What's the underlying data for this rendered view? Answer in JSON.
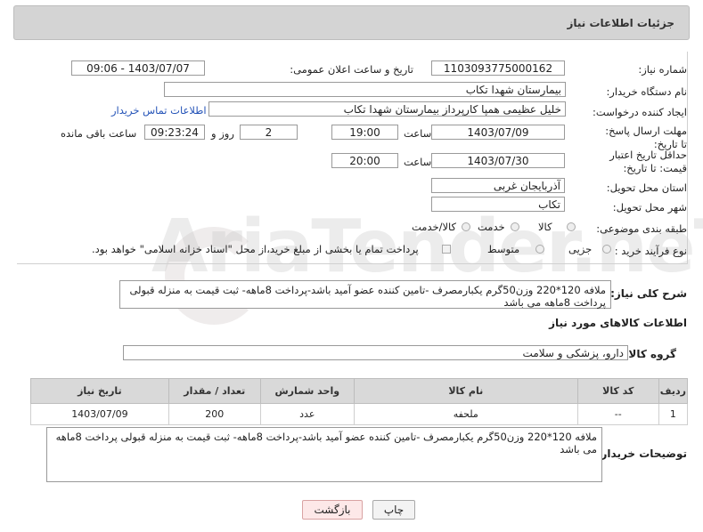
{
  "header": {
    "title": "جزئیات اطلاعات نیاز"
  },
  "form": {
    "need_number_label": "شماره نیاز:",
    "need_number": "1103093775000162",
    "announce_label": "تاریخ و ساعت اعلان عمومی:",
    "announce_value": "1403/07/07 - 09:06",
    "buyer_label": "نام دستگاه خریدار:",
    "buyer_value": "بیمارستان شهدا تکاب",
    "creator_label": "ایجاد کننده درخواست:",
    "creator_value": "خلیل عظیمی همپا کارپرداز بیمارستان شهدا تکاب",
    "contact_link": "اطلاعات تماس خریدار",
    "deadline_label": "مهلت ارسال پاسخ: تا تاریخ:",
    "deadline_date": "1403/07/09",
    "time_label": "ساعت",
    "deadline_time": "19:00",
    "days_value": "2",
    "days_label": "روز و",
    "remaining_time": "09:23:24",
    "remaining_label": "ساعت باقی مانده",
    "validity_label": "حداقل تاریخ اعتبار قیمت: تا تاریخ:",
    "validity_date": "1403/07/30",
    "validity_time": "20:00",
    "province_label": "استان محل تحویل:",
    "province_value": "آذربایجان غربی",
    "city_label": "شهر محل تحویل:",
    "city_value": "تکاب",
    "category_label": "طبقه بندی موضوعی:",
    "category_options": [
      "کالا",
      "خدمت",
      "کالا/خدمت"
    ],
    "process_label": "نوع فرآیند خرید :",
    "process_options": [
      "جزیی",
      "متوسط"
    ],
    "payment_note": "پرداخت تمام یا بخشی از مبلغ خرید،از محل \"اسناد خزانه اسلامی\" خواهد بود."
  },
  "summary": {
    "label": "شرح کلی نیاز:",
    "text": "ملافه 120*220 وزن50گرم یکبارمصرف -تامین کننده عضو آمید باشد-پرداخت 8ماهه- ثبت قیمت به منزله قبولی پرداخت 8ماهه می باشد"
  },
  "goods": {
    "title": "اطلاعات کالاهای مورد نیاز",
    "group_label": "گروه کالا:",
    "group_value": "دارو، پزشکی و سلامت",
    "columns": [
      "ردیف",
      "کد کالا",
      "نام کالا",
      "واحد شمارش",
      "تعداد / مقدار",
      "تاریخ نیاز"
    ],
    "rows": [
      [
        "1",
        "--",
        "ملحفه",
        "عدد",
        "200",
        "1403/07/09"
      ]
    ]
  },
  "buyer_notes": {
    "label": "توضیحات خریدار:",
    "text": "ملافه 120*220 وزن50گرم یکبارمصرف -تامین کننده عضو آمید باشد-پرداخت 8ماهه- ثبت قیمت به منزله قبولی پرداخت 8ماهه می باشد"
  },
  "buttons": {
    "print": "چاپ",
    "back": "بازگشت"
  },
  "watermark": "AriaTender.neT"
}
